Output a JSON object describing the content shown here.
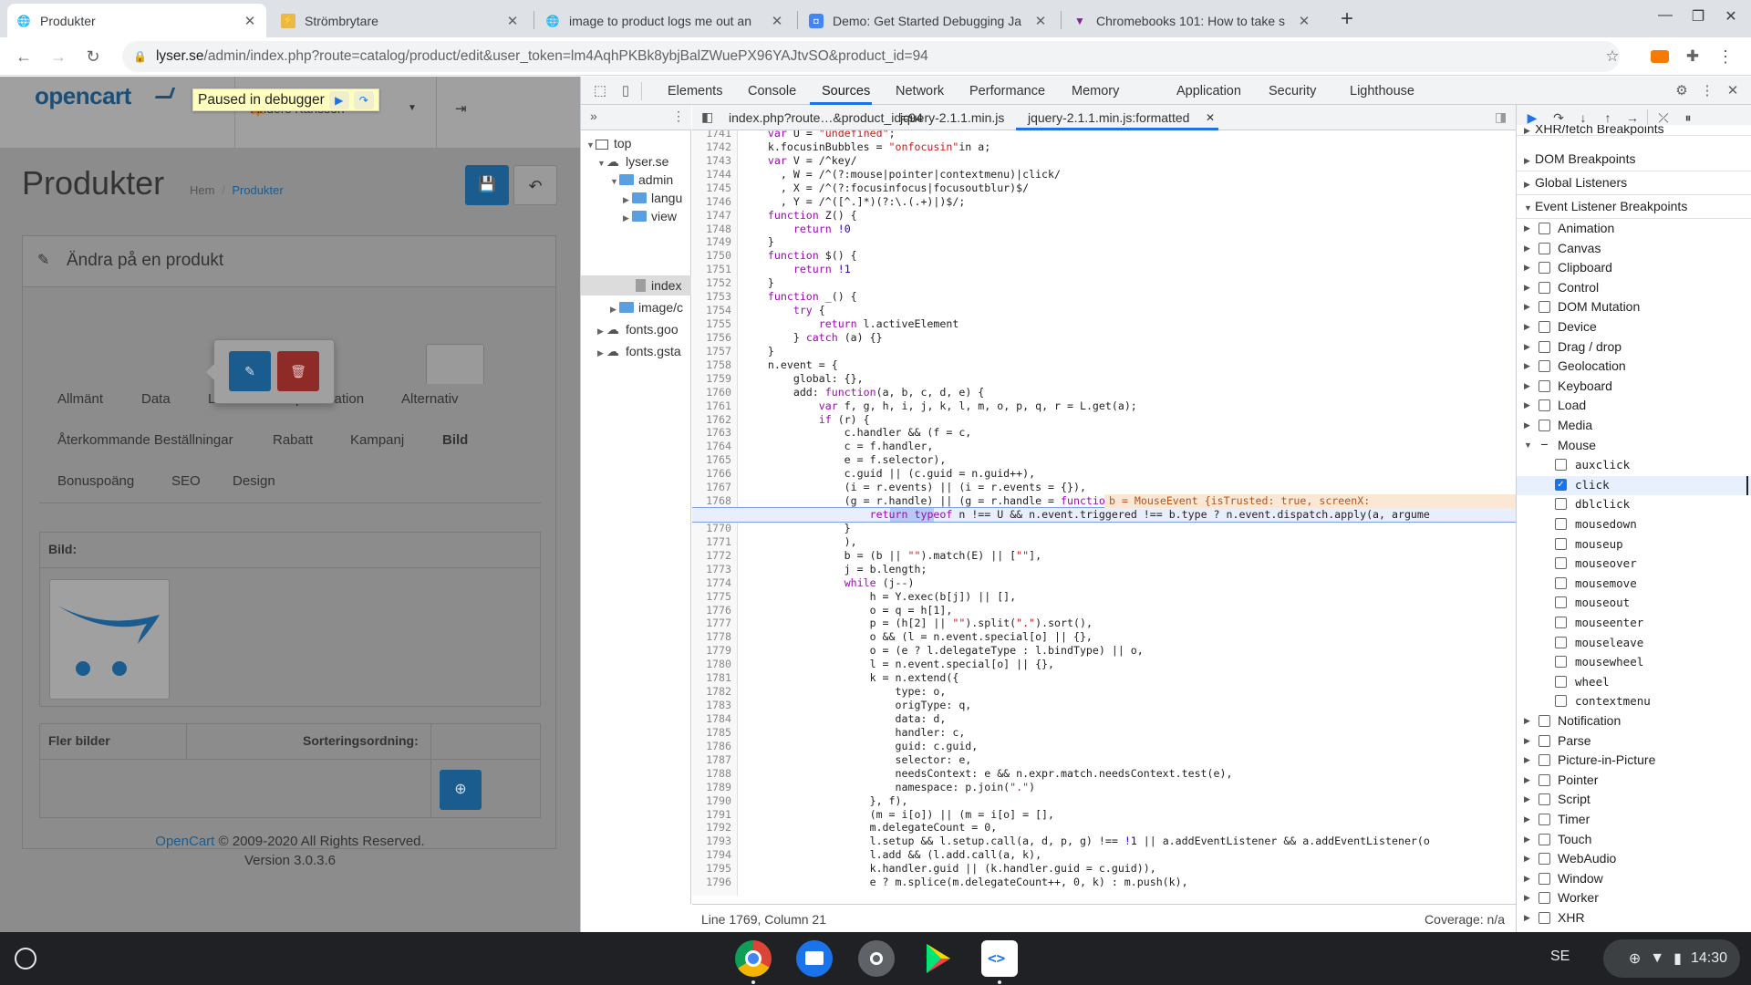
{
  "browser": {
    "tabs": [
      {
        "title": "Produkter",
        "favicon": "globe-icon",
        "active": true
      },
      {
        "title": "Strömbrytare",
        "favicon": "site-icon",
        "active": false
      },
      {
        "title": "image to product logs me out an",
        "favicon": "globe-icon",
        "active": false
      },
      {
        "title": "Demo: Get Started Debugging Ja",
        "favicon": "devtools-icon",
        "active": false
      },
      {
        "title": "Chromebooks 101: How to take s",
        "favicon": "v-icon",
        "active": false
      }
    ],
    "close_glyph": "✕",
    "new_tab_glyph": "+",
    "url_host": "lyser.se",
    "url_path": "/admin/index.php?route=catalog/product/edit&user_token=lm4AqhPKBk8ybjBalZWuePX96YAJtvSO&product_id=94"
  },
  "page": {
    "logo": "opencart",
    "debugger_banner": "Paused in debugger",
    "user_name": "Anders Karlsson",
    "title": "Produkter",
    "breadcrumb_home": "Hem",
    "breadcrumb_sep": "/",
    "breadcrumb_current": "Produkter",
    "panel_title": "Ändra på en produkt",
    "tabs": [
      "Allmänt",
      "Data",
      "Länkar",
      "Specifikation",
      "Alternativ",
      "Återkommande Beställningar",
      "Rabatt",
      "Kampanj",
      "Bild",
      "Bonuspoäng",
      "SEO",
      "Design"
    ],
    "active_tab": "Bild",
    "image_label": "Bild:",
    "more_images_label": "Fler bilder",
    "sort_order_label": "Sorteringsordning:",
    "footer_link": "OpenCart",
    "footer_text": " © 2009-2020 All Rights Reserved.",
    "footer_version": "Version 3.0.3.6"
  },
  "devtools": {
    "tabs": [
      "Elements",
      "Console",
      "Sources",
      "Network",
      "Performance",
      "Memory",
      "Application",
      "Security",
      "Lighthouse"
    ],
    "active_tab": "Sources",
    "file_tree": [
      {
        "label": "top",
        "kind": "frame"
      },
      {
        "label": "lyser.se",
        "kind": "cloud"
      },
      {
        "label": "admin",
        "kind": "folder"
      },
      {
        "label": "langu",
        "kind": "folder"
      },
      {
        "label": "view",
        "kind": "folder"
      },
      {
        "label": "index",
        "kind": "file"
      },
      {
        "label": "image/c",
        "kind": "folder"
      },
      {
        "label": "fonts.goo",
        "kind": "cloud"
      },
      {
        "label": "fonts.gsta",
        "kind": "cloud"
      }
    ],
    "editor_tabs": [
      "index.php?route…&product_id=94",
      "jquery-2.1.1.min.js",
      "jquery-2.1.1.min.js:formatted"
    ],
    "active_editor_tab": "jquery-2.1.1.min.js:formatted",
    "first_line": 1741,
    "code_lines": [
      "    var U = \"undefined\";",
      "    k.focusinBubbles = \"onfocusin\"in a;",
      "    var V = /^key/",
      "      , W = /^(?:mouse|pointer|contextmenu)|click/",
      "      , X = /^(?:focusinfocus|focusoutblur)$/",
      "      , Y = /^([^.]*)(?:\\.(.+)|)$/;",
      "    function Z() {",
      "        return !0",
      "    }",
      "    function $() {",
      "        return !1",
      "    }",
      "    function _() {",
      "        try {",
      "            return l.activeElement",
      "        } catch (a) {}",
      "    }",
      "    n.event = {",
      "        global: {},",
      "        add: function(a, b, c, d, e) {",
      "            var f, g, h, i, j, k, l, m, o, p, q, r = L.get(a);",
      "            if (r) {",
      "                c.handler && (f = c,",
      "                c = f.handler,",
      "                e = f.selector),",
      "                c.guid || (c.guid = n.guid++),",
      "                (i = r.events) || (i = r.events = {}),",
      "                (g = r.handle) || (g = r.handle = function(b) {",
      "                    return typeof n !== U && n.event.triggered !== b.type ? n.event.dispatch.apply(a, argume",
      "                }",
      "                ),",
      "                b = (b || \"\").match(E) || [\"\"],",
      "                j = b.length;",
      "                while (j--)",
      "                    h = Y.exec(b[j]) || [],",
      "                    o = q = h[1],",
      "                    p = (h[2] || \"\").split(\".\").sort(),",
      "                    o && (l = n.event.special[o] || {},",
      "                    o = (e ? l.delegateType : l.bindType) || o,",
      "                    l = n.event.special[o] || {},",
      "                    k = n.extend({",
      "                        type: o,",
      "                        origType: q,",
      "                        data: d,",
      "                        handler: c,",
      "                        guid: c.guid,",
      "                        selector: e,",
      "                        needsContext: e && n.expr.match.needsContext.test(e),",
      "                        namespace: p.join(\".\")",
      "                    }, f),",
      "                    (m = i[o]) || (m = i[o] = [],",
      "                    m.delegateCount = 0,",
      "                    l.setup && l.setup.call(a, d, p, g) !== !1 || a.addEventListener && a.addEventListener(o",
      "                    l.add && (l.add.call(a, k),",
      "                    k.handler.guid || (k.handler.guid = c.guid)),",
      "                    e ? m.splice(m.delegateCount++, 0, k) : m.push(k),"
    ],
    "paused_line": 1769,
    "inline_hint": "b = MouseEvent {isTrusted: true, screenX:",
    "status_left": "Line 1769, Column 21",
    "status_right": "Coverage: n/a",
    "sections": [
      "XHR/fetch Breakpoints",
      "DOM Breakpoints",
      "Global Listeners",
      "Event Listener Breakpoints"
    ],
    "breakpoints_before": [
      "Animation",
      "Canvas",
      "Clipboard",
      "Control",
      "DOM Mutation",
      "Device",
      "Drag / drop",
      "Geolocation",
      "Keyboard",
      "Load",
      "Media"
    ],
    "mouse_label": "Mouse",
    "mouse_events": [
      {
        "name": "auxclick",
        "checked": false
      },
      {
        "name": "click",
        "checked": true
      },
      {
        "name": "dblclick",
        "checked": false
      },
      {
        "name": "mousedown",
        "checked": false
      },
      {
        "name": "mouseup",
        "checked": false
      },
      {
        "name": "mouseover",
        "checked": false
      },
      {
        "name": "mousemove",
        "checked": false
      },
      {
        "name": "mouseout",
        "checked": false
      },
      {
        "name": "mouseenter",
        "checked": false
      },
      {
        "name": "mouseleave",
        "checked": false
      },
      {
        "name": "mousewheel",
        "checked": false
      },
      {
        "name": "wheel",
        "checked": false
      },
      {
        "name": "contextmenu",
        "checked": false
      }
    ],
    "breakpoints_after": [
      "Notification",
      "Parse",
      "Picture-in-Picture",
      "Pointer",
      "Script",
      "Timer",
      "Touch",
      "WebAudio",
      "Window",
      "Worker",
      "XHR"
    ]
  },
  "shelf": {
    "apps": [
      "chrome-icon",
      "files-icon",
      "camera-icon",
      "play-store-icon",
      "code-editor-icon"
    ],
    "lang": "SE",
    "time": "14:30"
  },
  "colors": {
    "accent": "#1a73e8",
    "oc_primary": "#1b5c8f",
    "oc_danger": "#8e2b27",
    "banner": "#ffffc0"
  }
}
